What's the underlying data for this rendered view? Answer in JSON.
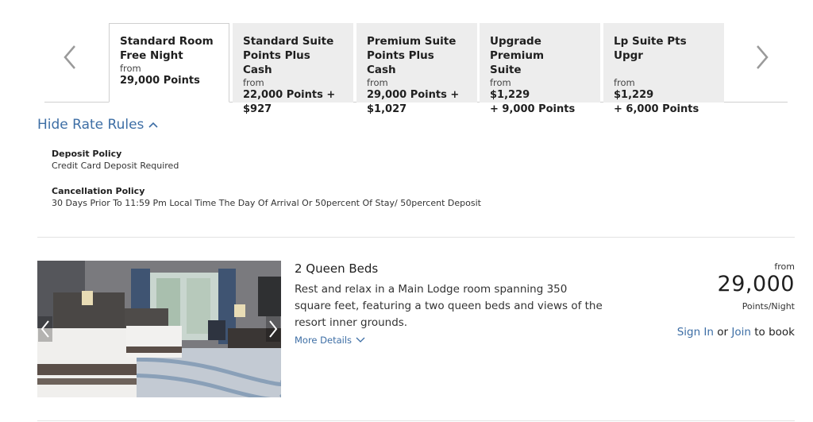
{
  "tabs": [
    {
      "title_line1": "Standard Room",
      "title_line2": "Free Night",
      "from": "from",
      "price_line1": "29,000 Points",
      "price_line2": ""
    },
    {
      "title_line1": "Standard Suite",
      "title_line2": "Points Plus Cash",
      "from": "from",
      "price_line1": "22,000 Points +",
      "price_line2": "$927"
    },
    {
      "title_line1": "Premium Suite",
      "title_line2": "Points Plus Cash",
      "from": "from",
      "price_line1": "29,000 Points +",
      "price_line2": "$1,027"
    },
    {
      "title_line1": "Upgrade Premium",
      "title_line2": "Suite",
      "from": "from",
      "price_line1": "$1,229",
      "price_line2": "+ 9,000 Points"
    },
    {
      "title_line1": "Lp Suite Pts Upgr",
      "title_line2": "",
      "from": "from",
      "price_line1": "$1,229",
      "price_line2": "+ 6,000 Points"
    }
  ],
  "rate_rules": {
    "toggle_label": "Hide Rate Rules",
    "deposit_label": "Deposit Policy",
    "deposit_text": "Credit Card Deposit Required",
    "cancellation_label": "Cancellation Policy",
    "cancellation_text": "30 Days Prior To 11:59 Pm Local Time The Day Of Arrival Or 50percent Of Stay/ 50percent Deposit"
  },
  "room": {
    "title": "2 Queen Beds",
    "description": "Rest and relax in a Main Lodge room spanning 350 square feet, featuring a two queen beds and views of the resort inner grounds.",
    "more_details": "More Details",
    "price_from": "from",
    "price": "29,000",
    "price_unit": "Points/Night",
    "sign_in": "Sign In",
    "or": "or",
    "join": "Join",
    "to_book": "to book"
  },
  "colors": {
    "link": "#3d6ea5",
    "tab_inactive": "#ededed",
    "divider": "#e2e2e2"
  },
  "icons": [
    "chevron-left-icon",
    "chevron-right-icon",
    "chevron-up-icon",
    "chevron-down-icon"
  ]
}
